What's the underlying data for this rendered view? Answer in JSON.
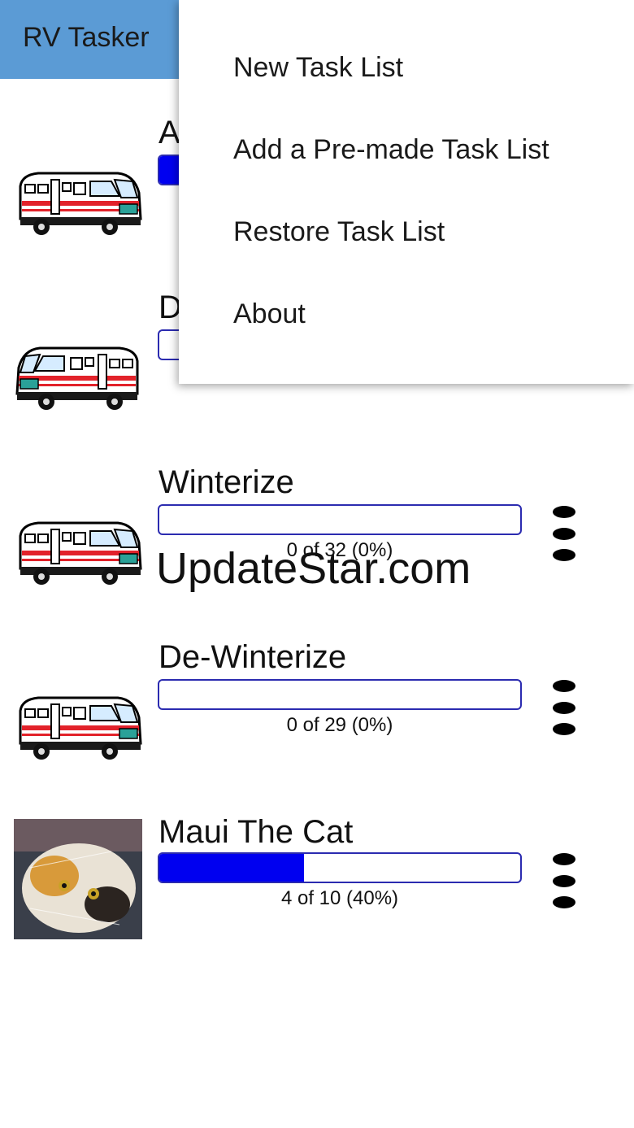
{
  "app": {
    "title": "RV Tasker"
  },
  "task_lists": [
    {
      "title": "A",
      "progress": 0.0,
      "caption": "",
      "thumb": "rv-icon",
      "fill_visible": true
    },
    {
      "title": "D",
      "progress": 0.0,
      "caption": "",
      "thumb": "rv-icon"
    },
    {
      "title": "Winterize",
      "progress": 0.0,
      "caption": "0 of 32 (0%)",
      "thumb": "rv-icon"
    },
    {
      "title": "De-Winterize",
      "progress": 0.0,
      "caption": "0 of 29 (0%)",
      "thumb": "rv-icon"
    },
    {
      "title": "Maui The Cat",
      "progress": 0.4,
      "caption": "4 of 10 (40%)",
      "thumb": "cat-photo"
    }
  ],
  "overflow_menu": {
    "items": [
      "New Task List",
      "Add a Pre-made Task List",
      "Restore Task List",
      "About"
    ]
  },
  "watermark": "UpdateStar.com",
  "colors": {
    "appbar": "#5b9bd5",
    "progress_fill": "#0000f0",
    "progress_border": "#2b2bb0"
  }
}
